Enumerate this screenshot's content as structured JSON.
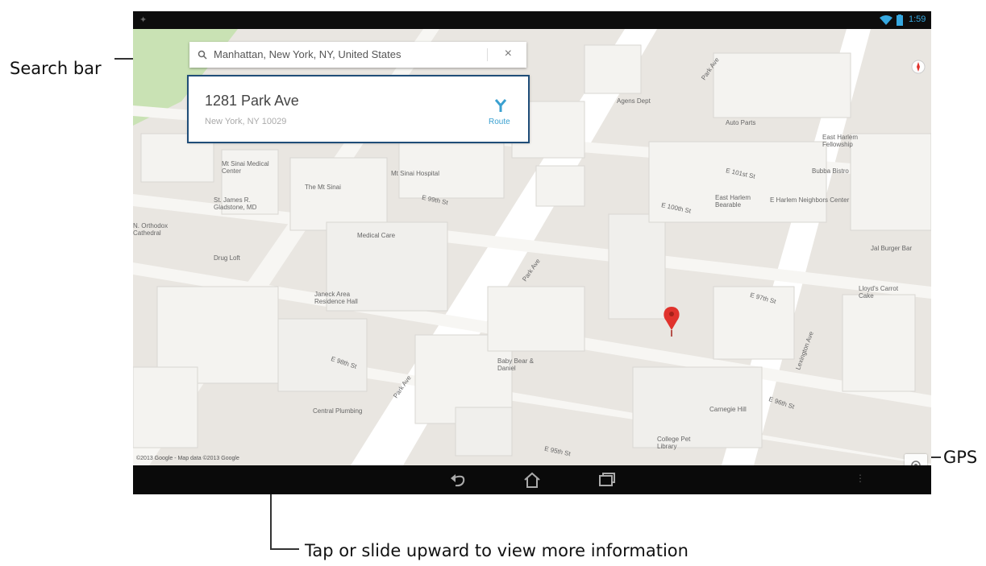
{
  "callouts": {
    "search_bar": "Search bar",
    "gps": "GPS",
    "info": "Tap or slide upward to view more information"
  },
  "status_bar": {
    "time": "1:59"
  },
  "search": {
    "query": "Manhattan, New York, NY, United States"
  },
  "result": {
    "name": "1281 Park Ave",
    "address": "New York, NY 10029",
    "route_label": "Route"
  },
  "map": {
    "copyright": "©2013 Google - Map data ©2013 Google",
    "labels": {
      "mt_sinai_medical": "Mt Sinai Medical Center",
      "mt_sinai_hospital": "Mt Sinai Hospital",
      "the_mt_sinai": "The Mt Sinai",
      "st_james": "St. James R. Gladstone, MD",
      "medical_care": "Medical Care",
      "drug_loft": "Drug Loft",
      "janeck": "Janeck Area Residence Hall",
      "agens_dept": "Agens Dept",
      "auto_parts": "Auto Parts",
      "east_harlem": "East Harlem Fellowship",
      "bobby_bistro": "Bubba Bistro",
      "harlem_hospital": "East Harlem Bearable",
      "harlem_center": "E Harlem Neighbors Center",
      "jal_burger": "Jal Burger Bar",
      "lloyds": "Lloyd's Carrot Cake",
      "baby_bear": "Baby Bear & Daniel",
      "central_plumbing": "Central Plumbing",
      "carnegie": "Carnegie Hill",
      "college_pet": "College Pet Library",
      "n_orthodox": "N. Orthodox Cathedral",
      "e_99th": "E 99th St",
      "e_100th": "E 100th St",
      "e_98th": "E 98th St",
      "e_97th": "E 97th St",
      "e_96th": "E 96th St",
      "e_95th": "E 95th St",
      "e_101st": "E 101st St",
      "park_ave_1": "Park Ave",
      "park_ave_2": "Park Ave",
      "park_ave_3": "Park Ave",
      "lexington": "Lexington Ave"
    }
  },
  "colors": {
    "map_bg": "#e9e6e1",
    "building": "#f4f3f0",
    "building_side": "#d9d7d2",
    "street": "#ffffff",
    "park": "#c9e2b4",
    "pin": "#e0322c",
    "accent": "#3aa0d0",
    "highlight_border": "#1f4d78"
  },
  "icons": {
    "search": "search-icon",
    "close": "close-icon",
    "route": "route-icon",
    "gps": "gps-icon",
    "wifi": "wifi-icon",
    "battery": "battery-icon",
    "back": "back-icon",
    "home": "home-icon",
    "recents": "recent-apps-icon",
    "menu": "menu-dots-icon"
  }
}
